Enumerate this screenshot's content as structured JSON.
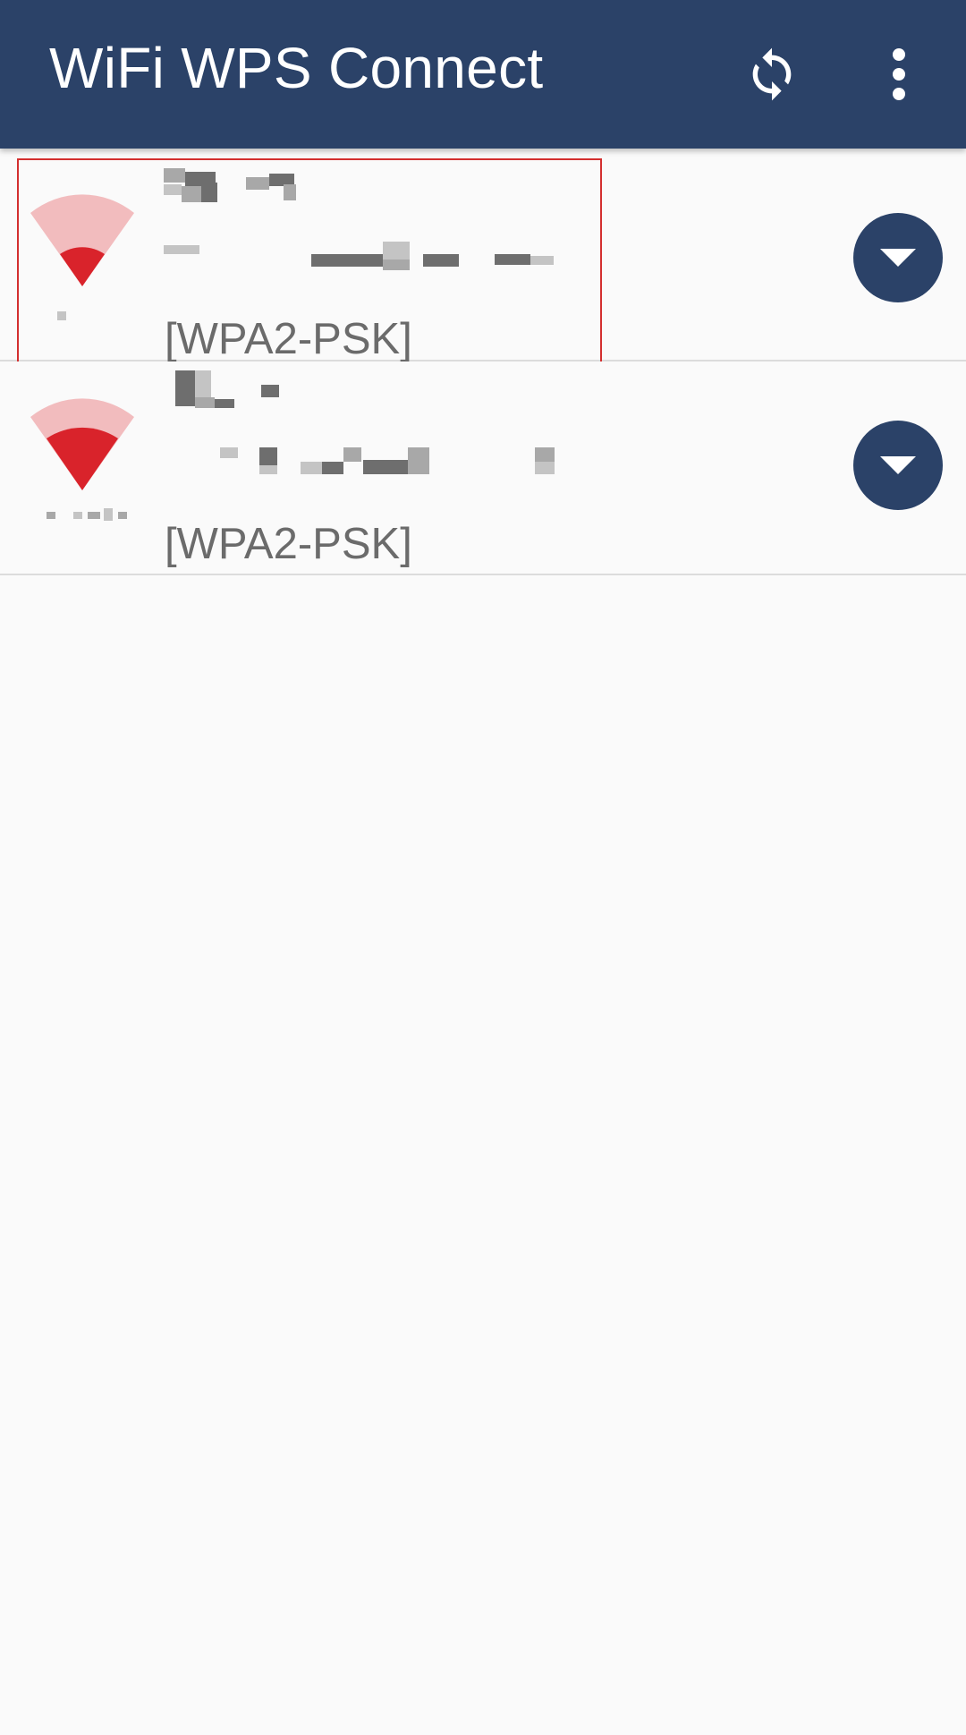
{
  "app_bar": {
    "title": "WiFi WPS Connect",
    "refresh_icon": "refresh-icon",
    "overflow_icon": "more-vert-icon",
    "background_color": "#2b4268"
  },
  "networks": [
    {
      "ssid": "",
      "bssid": "",
      "frequency": "",
      "security": "[WPA2-PSK]",
      "signal_level": 0.25,
      "selected": true,
      "expand_icon": "arrow-drop-down-icon"
    },
    {
      "ssid": "",
      "bssid": "",
      "frequency": "",
      "security": "[WPA2-PSK]",
      "signal_level": 0.55,
      "selected": false,
      "expand_icon": "arrow-drop-down-icon"
    }
  ],
  "colors": {
    "signal_strong": "#d9232b",
    "signal_weak": "#f2bcbe",
    "selection_border": "#d32f2f",
    "security_text": "#6b6b6b"
  }
}
